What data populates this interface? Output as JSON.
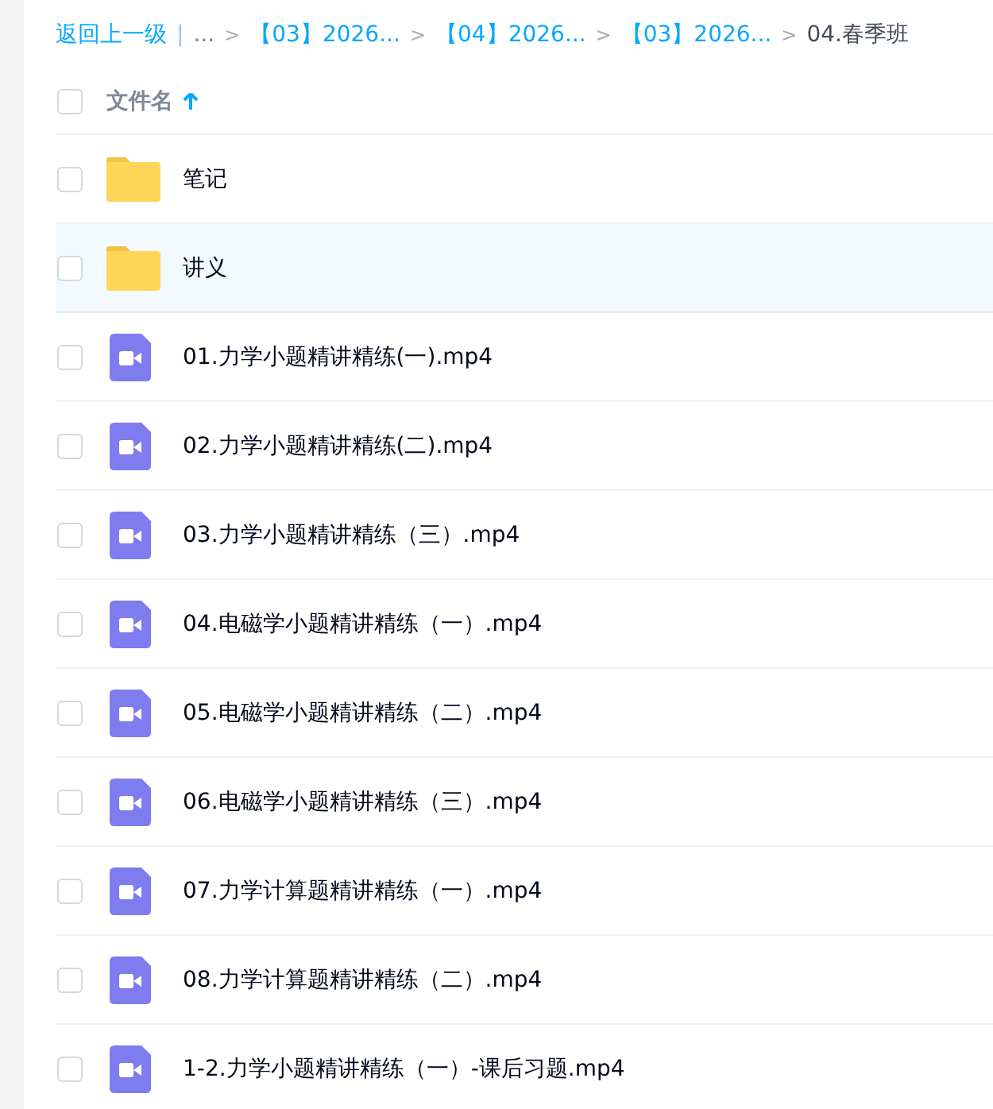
{
  "breadcrumb": {
    "back": "返回上一级",
    "divider": "|",
    "ellipsis": "...",
    "items": [
      {
        "separator": ">",
        "label": "【03】2026...",
        "current": false
      },
      {
        "separator": ">",
        "label": "【04】2026...",
        "current": false
      },
      {
        "separator": ">",
        "label": "【03】2026...",
        "current": false
      },
      {
        "separator": ">",
        "label": "04.春季班",
        "current": true
      }
    ]
  },
  "header": {
    "checked": false,
    "column": "文件名",
    "sort_ascending": true
  },
  "files": [
    {
      "kind": "folder",
      "name": "笔记",
      "checked": false,
      "highlighted": false
    },
    {
      "kind": "folder",
      "name": "讲义",
      "checked": false,
      "highlighted": true
    },
    {
      "kind": "video",
      "name": "01.力学小题精讲精练(一).mp4",
      "checked": false,
      "highlighted": false
    },
    {
      "kind": "video",
      "name": "02.力学小题精讲精练(二).mp4",
      "checked": false,
      "highlighted": false
    },
    {
      "kind": "video",
      "name": "03.力学小题精讲精练（三）.mp4",
      "checked": false,
      "highlighted": false
    },
    {
      "kind": "video",
      "name": "04.电磁学小题精讲精练（一）.mp4",
      "checked": false,
      "highlighted": false
    },
    {
      "kind": "video",
      "name": "05.电磁学小题精讲精练（二）.mp4",
      "checked": false,
      "highlighted": false
    },
    {
      "kind": "video",
      "name": "06.电磁学小题精讲精练（三）.mp4",
      "checked": false,
      "highlighted": false
    },
    {
      "kind": "video",
      "name": "07.力学计算题精讲精练（一）.mp4",
      "checked": false,
      "highlighted": false
    },
    {
      "kind": "video",
      "name": "08.力学计算题精讲精练（二）.mp4",
      "checked": false,
      "highlighted": false
    },
    {
      "kind": "video",
      "name": "1-2.力学小题精讲精练（一）-课后习题.mp4",
      "checked": false,
      "highlighted": false
    }
  ]
}
